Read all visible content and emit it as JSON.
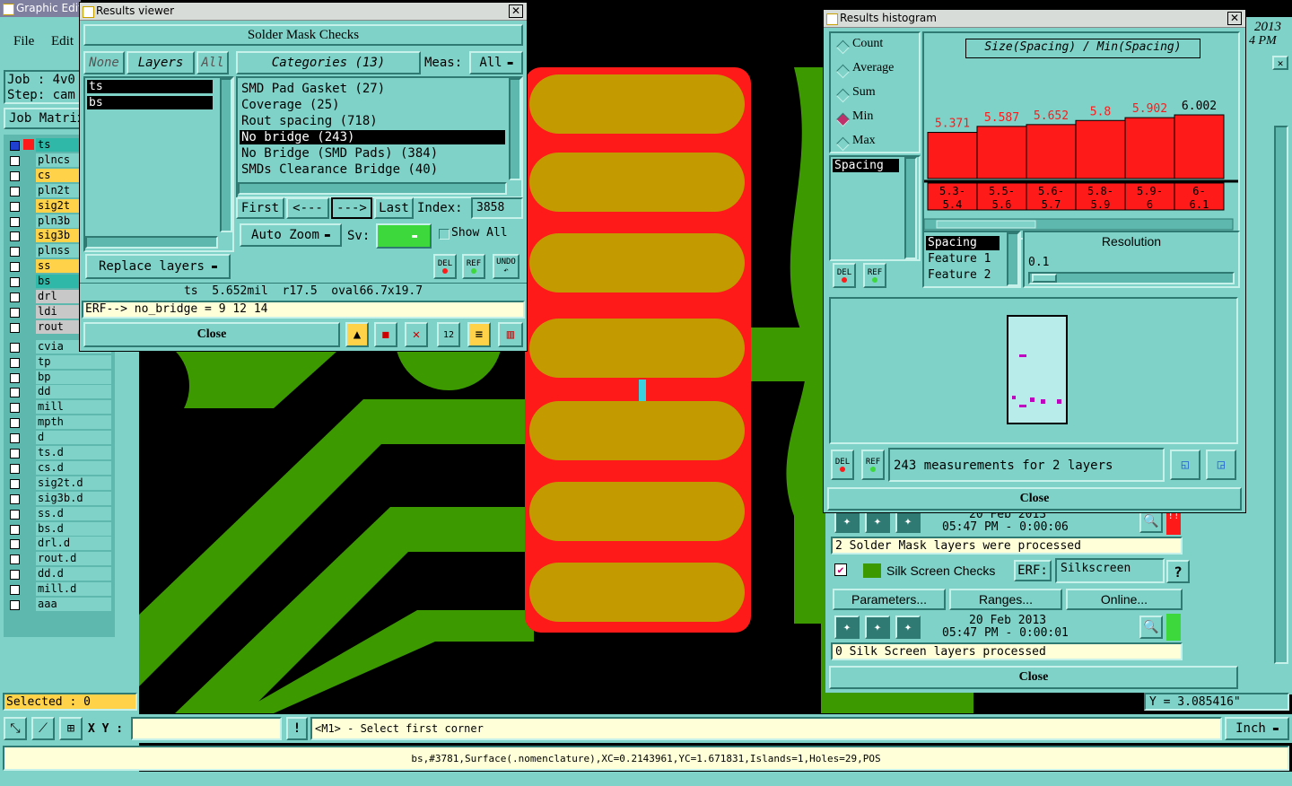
{
  "main_window": {
    "title": "Graphic Editor",
    "menu": [
      "File",
      "Edit"
    ],
    "job_label": "Job : 4v0",
    "step_label": "Step: cam",
    "job_matrix_label": "Job Matrix",
    "date_fragment": "2013",
    "time_fragment": "4 PM",
    "selected_label": "Selected : 0",
    "xy_label": "X Y :",
    "xy_value": "",
    "prompt": "<M1> - Select first corner",
    "units": "Inch",
    "y_coord": "Y = 3.085416\"",
    "status": "bs,#3781,Surface(.nomenclature),XC=0.2143961,YC=1.671831,Islands=1,Holes=29,POS"
  },
  "layers": [
    {
      "name": "ts",
      "color": "#2fb8a8"
    },
    {
      "name": "plncs",
      "color": "#7fd2c8"
    },
    {
      "name": "cs",
      "color": "#ffd24a"
    },
    {
      "name": "pln2t",
      "color": "#7fd2c8"
    },
    {
      "name": "sig2t",
      "color": "#ffd24a"
    },
    {
      "name": "pln3b",
      "color": "#7fd2c8"
    },
    {
      "name": "sig3b",
      "color": "#ffd24a"
    },
    {
      "name": "plnss",
      "color": "#7fd2c8"
    },
    {
      "name": "ss",
      "color": "#ffd24a"
    },
    {
      "name": "bs",
      "color": "#2fb8a8"
    },
    {
      "name": "drl",
      "color": "#c8c8c8"
    },
    {
      "name": "ldi",
      "color": "#c8c8c8"
    },
    {
      "name": "rout",
      "color": "#c8c8c8"
    },
    {
      "name": "cvia",
      "color": "#7fd2c8"
    },
    {
      "name": "tp",
      "color": "#7fd2c8"
    },
    {
      "name": "bp",
      "color": "#7fd2c8"
    },
    {
      "name": "dd",
      "color": "#7fd2c8"
    },
    {
      "name": "mill",
      "color": "#7fd2c8"
    },
    {
      "name": "mpth",
      "color": "#7fd2c8"
    },
    {
      "name": "d",
      "color": "#7fd2c8"
    },
    {
      "name": "ts.d",
      "color": "#7fd2c8"
    },
    {
      "name": "cs.d",
      "color": "#7fd2c8"
    },
    {
      "name": "sig2t.d",
      "color": "#7fd2c8"
    },
    {
      "name": "sig3b.d",
      "color": "#7fd2c8"
    },
    {
      "name": "ss.d",
      "color": "#7fd2c8"
    },
    {
      "name": "bs.d",
      "color": "#7fd2c8"
    },
    {
      "name": "drl.d",
      "color": "#7fd2c8"
    },
    {
      "name": "rout.d",
      "color": "#7fd2c8"
    },
    {
      "name": "dd.d",
      "color": "#7fd2c8"
    },
    {
      "name": "mill.d",
      "color": "#7fd2c8"
    },
    {
      "name": "aaa",
      "color": "#7fd2c8"
    }
  ],
  "results_viewer": {
    "title": "Results viewer",
    "header": "Solder Mask Checks",
    "none_btn": "None",
    "layers_btn": "Layers",
    "all_btn": "All",
    "categories_btn": "Categories (13)",
    "meas_label": "Meas:",
    "meas_value": "All",
    "layer_list": [
      "ts",
      "bs"
    ],
    "categories": [
      "SMD Pad Gasket (27)",
      "Coverage (25)",
      "Rout spacing (718)",
      "No bridge (243)",
      "No Bridge (SMD Pads) (384)",
      "SMDs Clearance Bridge (40)"
    ],
    "selected_category": "No bridge (243)",
    "first_btn": "First",
    "prev_btn": "<---",
    "next_btn": "--->",
    "last_btn": "Last",
    "index_label": "Index:",
    "index_value": "3858",
    "auto_zoom": "Auto Zoom",
    "sv_label": "Sv:",
    "show_all": "Show All",
    "replace_layers": "Replace layers",
    "del_label": "DEL",
    "ref_label": "REF",
    "undo_label": "UNDO",
    "info_line": "ts  5.652mil  r17.5  oval66.7x19.7",
    "erf_line": "ERF--> no_bridge = 9 12 14",
    "close_btn": "Close"
  },
  "results_histogram": {
    "title": "Results histogram",
    "options": [
      "Count",
      "Average",
      "Sum",
      "Min",
      "Max"
    ],
    "selected_option": "Min",
    "chart_title": "Size(Spacing) / Min(Spacing)",
    "measure_list": [
      "Spacing"
    ],
    "feature_list": [
      "Spacing",
      "Feature 1",
      "Feature 2"
    ],
    "resolution_label": "Resolution",
    "resolution_value": "0.1",
    "summary": "243 measurements for 2 layers",
    "close_btn": "Close",
    "del_label": "DEL",
    "ref_label": "REF"
  },
  "chart_data": {
    "type": "bar",
    "title": "Size(Spacing) / Min(Spacing)",
    "categories": [
      "5.3-5.4",
      "5.5-5.6",
      "5.6-5.7",
      "5.8-5.9",
      "5.9-6",
      "6-6.1"
    ],
    "values": [
      5.371,
      5.587,
      5.652,
      5.8,
      5.902,
      6.002
    ],
    "value_labels": [
      "5.371",
      "5.587",
      "5.652",
      "5.8",
      "5.902",
      "6.002"
    ],
    "category_labels_top": [
      "5.3-",
      "5.5-",
      "5.6-",
      "5.8-",
      "5.9-",
      "6-"
    ],
    "category_labels_bottom": [
      "5.4",
      "5.6",
      "5.7",
      "5.9",
      "6",
      "6.1"
    ],
    "label_colors": [
      "#ff1a1a",
      "#ff1a1a",
      "#ff1a1a",
      "#ff1a1a",
      "#ff1a1a",
      "#000000"
    ],
    "ylim": [
      0,
      6.5
    ]
  },
  "analysis_panel": {
    "solder_date": "20 Feb 2013",
    "solder_time": "05:47 PM - 0:00:06",
    "solder_msg": "2 Solder Mask layers were processed",
    "silk_title": "Silk Screen Checks",
    "erf_label": "ERF:",
    "erf_value": "Silkscreen",
    "help": "?",
    "parameters_btn": "Parameters...",
    "ranges_btn": "Ranges...",
    "online_btn": "Online...",
    "silk_date": "20 Feb 2013",
    "silk_time": "05:47 PM - 0:00:01",
    "silk_msg": "0 Silk Screen layers processed",
    "close_btn": "Close",
    "alert": "!!"
  },
  "colors": {
    "panel": "#7fd2c8",
    "pcb_green": "#3c9a00",
    "pad_orange": "#c39a00",
    "mask_red": "#ff1a1a"
  }
}
